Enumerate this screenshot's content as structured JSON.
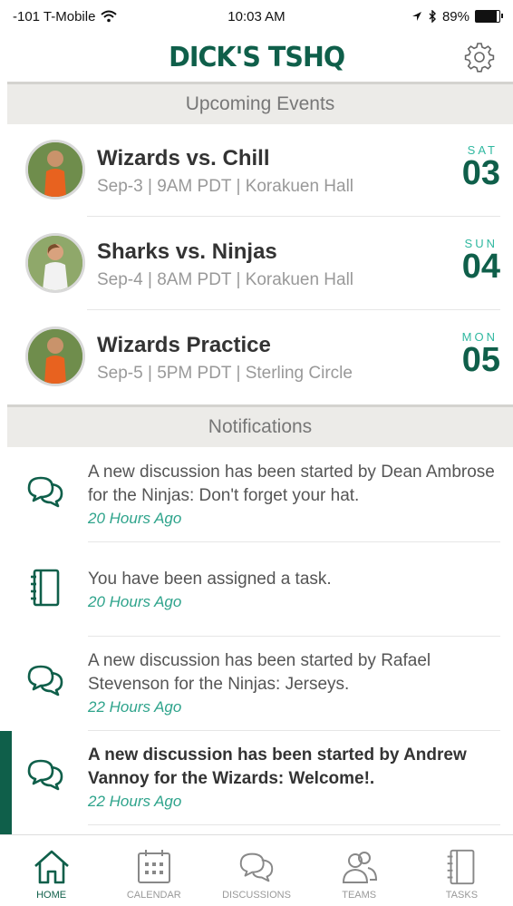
{
  "status_bar": {
    "carrier": "-101 T-Mobile",
    "time": "10:03 AM",
    "battery": "89%",
    "battery_level": 0.89
  },
  "header": {
    "brand": "DICK'S TSHQ"
  },
  "upcoming_events": {
    "title": "Upcoming Events",
    "items": [
      {
        "title": "Wizards vs. Chill",
        "details": "Sep-3 | 9AM PDT | Korakuen Hall",
        "day": "SAT",
        "date": "03"
      },
      {
        "title": "Sharks vs. Ninjas",
        "details": "Sep-4 | 8AM PDT | Korakuen Hall",
        "day": "SUN",
        "date": "04"
      },
      {
        "title": "Wizards Practice",
        "details": "Sep-5 | 5PM PDT | Sterling Circle",
        "day": "MON",
        "date": "05"
      }
    ]
  },
  "notifications": {
    "title": "Notifications",
    "items": [
      {
        "icon": "chat-bubbles-icon",
        "text": "A new discussion has been started by Dean Ambrose for the Ninjas: Don't forget your hat.",
        "time": "20 Hours Ago"
      },
      {
        "icon": "notebook-icon",
        "text": "You have been assigned a task.",
        "time": "20 Hours Ago"
      },
      {
        "icon": "chat-bubbles-icon",
        "text": "A new discussion has been started by Rafael Stevenson for the Ninjas: Jerseys.",
        "time": "22 Hours Ago"
      },
      {
        "icon": "chat-bubbles-icon",
        "text": "A new discussion has been started by Andrew Vannoy for the Wizards: Welcome!.",
        "time": "22 Hours Ago",
        "unread": true
      }
    ]
  },
  "tabs": [
    {
      "label": "HOME",
      "icon": "home-icon",
      "active": true
    },
    {
      "label": "CALENDAR",
      "icon": "calendar-icon"
    },
    {
      "label": "DISCUSSIONS",
      "icon": "chat-bubbles-icon"
    },
    {
      "label": "TEAMS",
      "icon": "people-icon"
    },
    {
      "label": "TASKS",
      "icon": "notebook-icon"
    }
  ],
  "colors": {
    "brand_green": "#0f5f4a",
    "accent_teal": "#2fa48c",
    "section_bg": "#ecebe8"
  }
}
